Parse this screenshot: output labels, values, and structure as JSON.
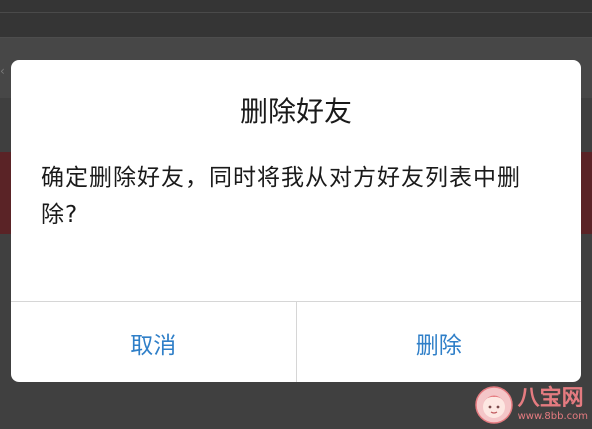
{
  "dialog": {
    "title": "删除好友",
    "message": "确定删除好友，同时将我从对方好友列表中删除?",
    "cancel_label": "取消",
    "confirm_label": "删除"
  },
  "watermark": {
    "name": "八宝网",
    "url": "www.8bb.com"
  },
  "colors": {
    "accent": "#2f7fc8",
    "watermark": "#e57b80",
    "overlay": "#3f3f3f"
  },
  "icons": {
    "watermark_logo": "baby-face-logo"
  }
}
